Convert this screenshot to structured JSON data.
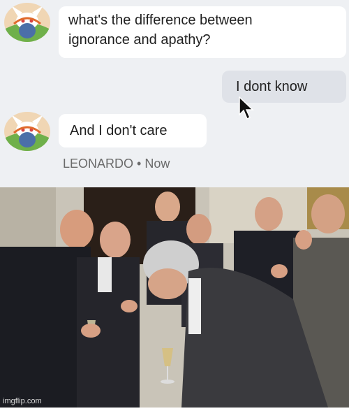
{
  "chat": {
    "question": "what's the difference between\nignorance and apathy?",
    "my_reply": "I dont know",
    "bot_reply": "And I don't care",
    "sender_name": "LEONARDO",
    "separator": "•",
    "time": "Now"
  },
  "meme": {
    "watermark": "imgflip.com"
  },
  "icons": {
    "avatar": "bunny-avatar-icon",
    "cursor": "mouse-pointer-icon"
  },
  "colors": {
    "chat_background": "#eef0f3",
    "bubble": "#ffffff",
    "my_bubble": "#dfe2e8",
    "meta_text": "#6b6b6b"
  }
}
